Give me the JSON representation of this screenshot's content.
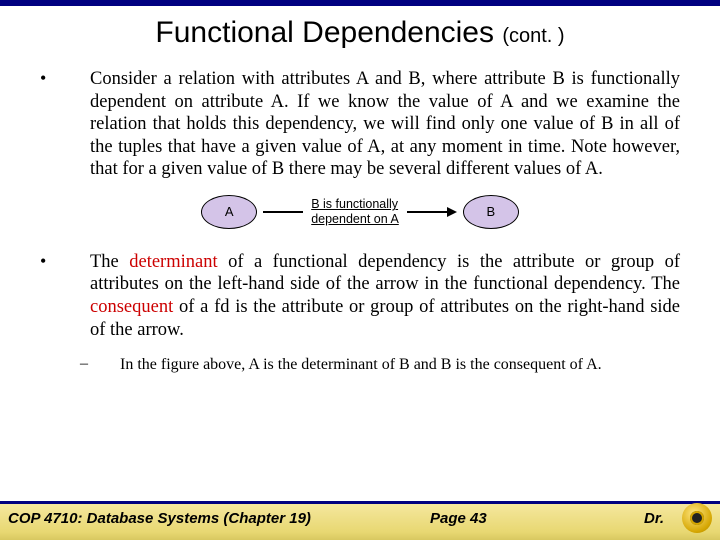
{
  "title_main": "Functional Dependencies ",
  "title_cont": "(cont. )",
  "para1": "Consider a relation with attributes A and B, where attribute B is functionally dependent on attribute A.  If we know the value of A and we examine the relation that holds this dependency, we will find only one value of B in all of the tuples that have a given value of A, at any moment in time.  Note however, that for a given value of B there may be several different values of A.",
  "diagram": {
    "left": "A",
    "mid_line1": "B is functionally",
    "mid_line2": "dependent on A",
    "right": "B"
  },
  "para2_pre": "The ",
  "para2_red1": "determinant",
  "para2_mid": " of a functional dependency is the attribute or group of attributes on the left-hand side of the arrow in the functional dependency.  The ",
  "para2_red2": "consequent",
  "para2_post": " of a fd is the attribute or group of attributes on the right-hand side of the arrow.",
  "subbullet": "In the figure above, A is the determinant of B and B is the consequent of A.",
  "footer": {
    "left": "COP 4710: Database Systems  (Chapter 19)",
    "page": "Page 43",
    "right": "Dr."
  }
}
